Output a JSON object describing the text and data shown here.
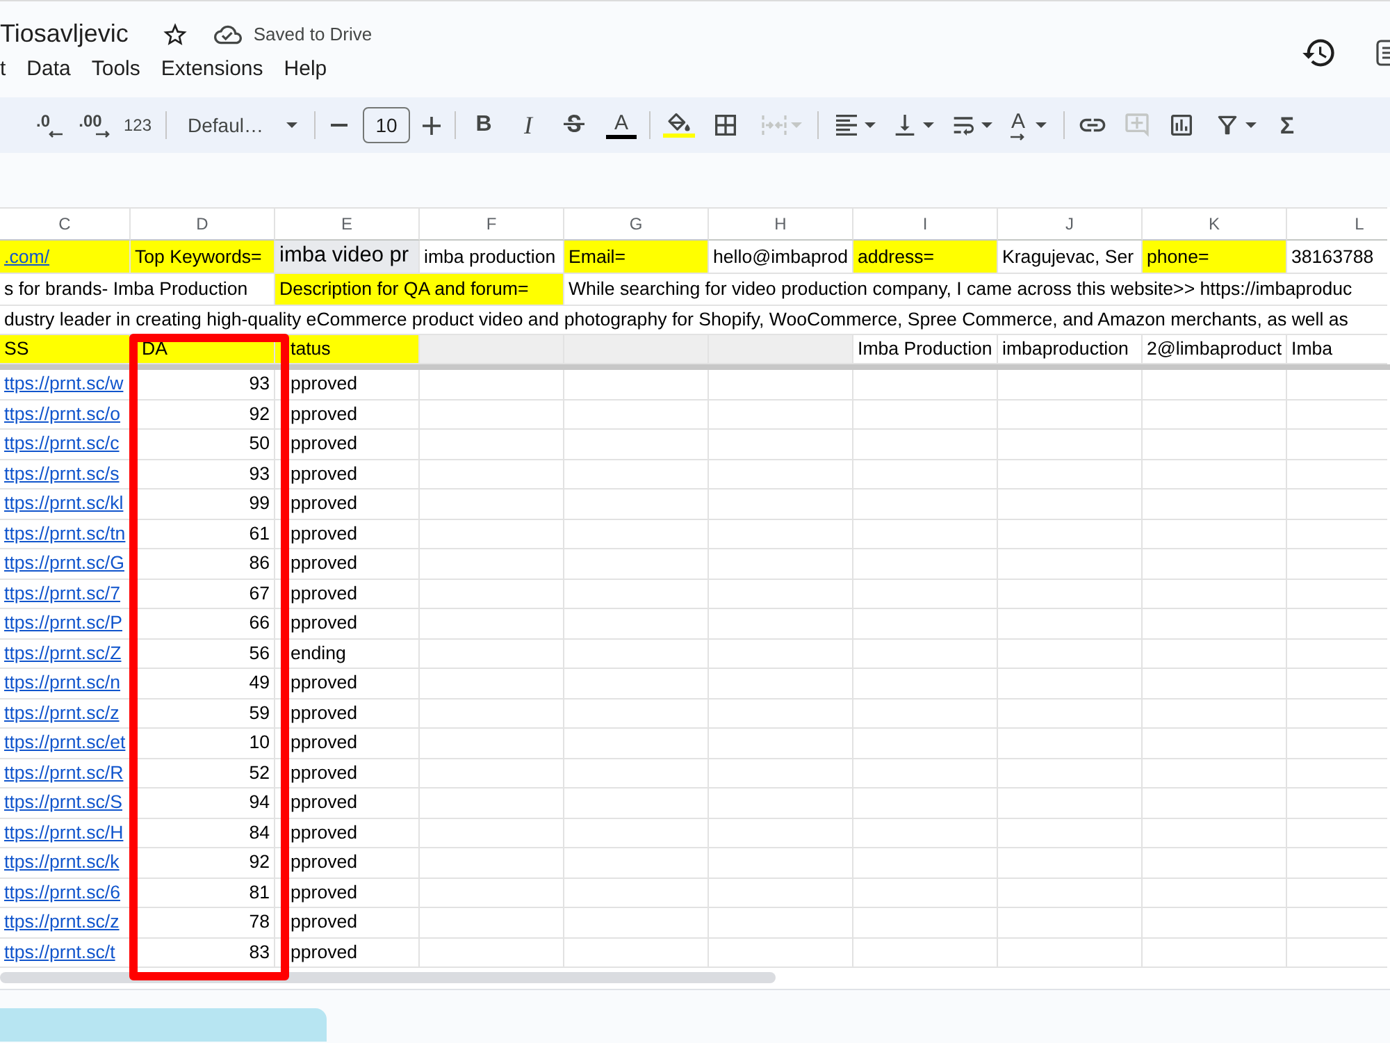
{
  "document": {
    "title": "Tiosavljevic",
    "save_status": "Saved to Drive"
  },
  "menu": [
    "t",
    "Data",
    "Tools",
    "Extensions",
    "Help"
  ],
  "toolbar": {
    "decrease_decimal": ".0",
    "increase_decimal": ".00",
    "number_format": "123",
    "font": "Defaul…",
    "font_size": "10",
    "bold": "B",
    "italic": "I",
    "text_color": {
      "label": "A",
      "color": "#000000"
    },
    "fill_color": {
      "color": "#ffff00"
    },
    "merge_cells": {
      "disabled": true
    },
    "text_rotation": "A",
    "insert_comment": {
      "disabled": true
    },
    "functions": "Σ"
  },
  "sheet": {
    "columns": [
      "C",
      "D",
      "E",
      "F",
      "G",
      "H",
      "I",
      "J",
      "K",
      "L"
    ],
    "frozen_rows": [
      {
        "cells": [
          {
            "text": ".com/",
            "kind": "link",
            "color": "#ffff00"
          },
          {
            "text": "Top Keywords=",
            "kind": "text",
            "color": "#ffff00"
          },
          {
            "text": "imba video pr",
            "kind": "large",
            "color": "#e8eaed"
          },
          {
            "text": "imba production",
            "kind": "text"
          },
          {
            "text": "Email=",
            "kind": "text",
            "color": "#ffff00"
          },
          {
            "text": "hello@imbaprod",
            "kind": "text"
          },
          {
            "text": "address=",
            "kind": "text",
            "color": "#ffff00"
          },
          {
            "text": "Kragujevac, Ser",
            "kind": "text"
          },
          {
            "text": "phone=",
            "kind": "text",
            "color": "#ffff00"
          },
          {
            "text": "38163788",
            "kind": "text"
          }
        ]
      },
      {
        "cells": [
          {
            "text": "s for brands- Imba Production",
            "kind": "text"
          },
          null,
          {
            "text": "Description for QA and forum=",
            "kind": "text",
            "color": "#ffff00"
          },
          null,
          {
            "text": "While searching for video production company, I came across this website>> https://imbaproduc",
            "kind": "text"
          },
          null,
          null,
          null,
          null,
          null
        ]
      },
      {
        "cells": [
          {
            "text": "dustry leader in creating high-quality eCommerce product video and photography for Shopify, WooCommerce, Spree Commerce, and Amazon merchants, as well as",
            "kind": "text"
          },
          null,
          null,
          null,
          null,
          null,
          null,
          null,
          null,
          null
        ]
      },
      {
        "cells": [
          {
            "text": "SS",
            "kind": "text",
            "color": "#ffff00"
          },
          {
            "text": "DA",
            "kind": "text",
            "color": "#ffff00"
          },
          {
            "text": "tatus",
            "kind": "text",
            "color": "#ffff00"
          },
          {
            "color": "#eeeeee"
          },
          {
            "color": "#eeeeee"
          },
          {
            "color": "#eeeeee"
          },
          {
            "text": "Imba Production",
            "kind": "text"
          },
          {
            "text": "imbaproduction",
            "kind": "text"
          },
          {
            "text": "2@limbaproduct",
            "kind": "text"
          },
          {
            "text": "Imba",
            "kind": "text"
          }
        ]
      }
    ],
    "rows": [
      {
        "link": "ttps://prnt.sc/w",
        "da": "93",
        "status": "pproved"
      },
      {
        "link": "ttps://prnt.sc/o",
        "da": "92",
        "status": "pproved"
      },
      {
        "link": "ttps://prnt.sc/c",
        "da": "50",
        "status": "pproved"
      },
      {
        "link": "ttps://prnt.sc/s",
        "da": "93",
        "status": "pproved"
      },
      {
        "link": "ttps://prnt.sc/kl",
        "da": "99",
        "status": "pproved"
      },
      {
        "link": "ttps://prnt.sc/tn",
        "da": "61",
        "status": "pproved"
      },
      {
        "link": "ttps://prnt.sc/G",
        "da": "86",
        "status": "pproved"
      },
      {
        "link": "ttps://prnt.sc/7",
        "da": "67",
        "status": "pproved"
      },
      {
        "link": "ttps://prnt.sc/P",
        "da": "66",
        "status": "pproved"
      },
      {
        "link": "ttps://prnt.sc/Z",
        "da": "56",
        "status": "ending"
      },
      {
        "link": "ttps://prnt.sc/n",
        "da": "49",
        "status": "pproved"
      },
      {
        "link": "ttps://prnt.sc/z",
        "da": "59",
        "status": "pproved"
      },
      {
        "link": "ttps://prnt.sc/et",
        "da": "10",
        "status": "pproved"
      },
      {
        "link": "ttps://prnt.sc/R",
        "da": "52",
        "status": "pproved"
      },
      {
        "link": "ttps://prnt.sc/S",
        "da": "94",
        "status": "pproved"
      },
      {
        "link": "ttps://prnt.sc/H",
        "da": "84",
        "status": "pproved"
      },
      {
        "link": "ttps://prnt.sc/k",
        "da": "92",
        "status": "pproved"
      },
      {
        "link": "ttps://prnt.sc/6",
        "da": "81",
        "status": "pproved"
      },
      {
        "link": "ttps://prnt.sc/z",
        "da": "78",
        "status": "pproved"
      },
      {
        "link": "ttps://prnt.sc/t",
        "da": "83",
        "status": "pproved"
      }
    ]
  },
  "sheet_tabs": [
    {
      "selected": true
    }
  ]
}
